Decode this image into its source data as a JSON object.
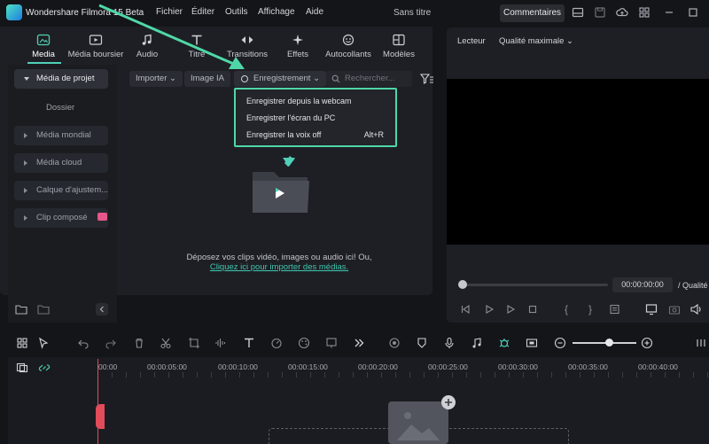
{
  "app": {
    "name": "Wondershare Filmora 15 Beta",
    "doc_title": "Sans titre",
    "comments_label": "Commentaires"
  },
  "menu": [
    "Fichier",
    "Éditer",
    "Outils",
    "Affichage",
    "Aide"
  ],
  "tabs": [
    {
      "label": "Media",
      "icon": "media-icon"
    },
    {
      "label": "Média boursier",
      "icon": "stock-media-icon"
    },
    {
      "label": "Audio",
      "icon": "music-note-icon"
    },
    {
      "label": "Titre",
      "icon": "text-T-icon"
    },
    {
      "label": "Transitions",
      "icon": "transition-arrows-icon"
    },
    {
      "label": "Effets",
      "icon": "sparkle-icon"
    },
    {
      "label": "Autocollants",
      "icon": "sticker-icon"
    },
    {
      "label": "Modèles",
      "icon": "template-icon"
    }
  ],
  "sidebar": {
    "items": [
      {
        "label": "Média de projet"
      },
      {
        "label": "Média mondial"
      },
      {
        "label": "Média cloud"
      },
      {
        "label": "Calque d'ajustem..."
      },
      {
        "label": "Clip composé"
      }
    ],
    "sub_item": "Dossier"
  },
  "media_toolbar": {
    "import_label": "Importer",
    "image_ai_label": "Image IA",
    "record_label": "Enregistrement",
    "search_placeholder": "Rechercher..."
  },
  "record_menu": {
    "items": [
      {
        "label": "Enregistrer depuis la webcam",
        "shortcut": ""
      },
      {
        "label": "Enregistrer l'écran du PC",
        "shortcut": ""
      },
      {
        "label": "Enregistrer la voix off",
        "shortcut": "Alt+R"
      }
    ]
  },
  "drop_area": {
    "hint": "Déposez vos clips vidéo, images ou audio ici! Ou,",
    "link": "Cliquez ici pour importer des médias."
  },
  "player": {
    "label": "Lecteur",
    "quality": "Qualité maximale",
    "timecode": "00:00:00:00",
    "quality_short": "/ Qualité"
  },
  "timeline": {
    "ruler": [
      "00:00",
      "00:00:05:00",
      "00:00:10:00",
      "00:00:15:00",
      "00:00:20:00",
      "00:00:25:00",
      "00:00:30:00",
      "00:00:35:00",
      "00:00:40:00"
    ]
  },
  "colors": {
    "accent": "#4fd1b8",
    "highlight_border": "#4fd8a7",
    "playhead": "#e14c5a",
    "background": "#141519"
  }
}
